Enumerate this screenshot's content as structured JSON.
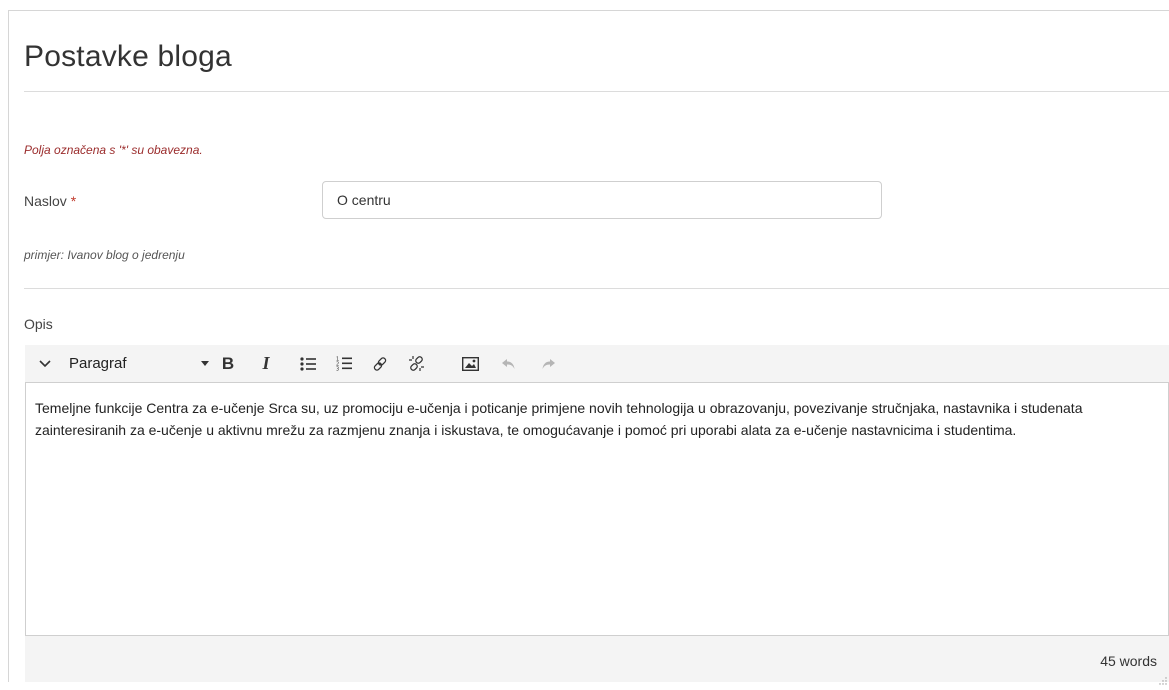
{
  "page": {
    "title": "Postavke bloga",
    "required_note": "Polja označena s '*' su obavezna."
  },
  "form": {
    "naslov_label": "Naslov",
    "required_mark": "*",
    "naslov_value": "O centru",
    "naslov_hint": "primjer: Ivanov blog o jedrenju",
    "opis_label": "Opis"
  },
  "editor": {
    "toolbar": {
      "collapse_icon": "chevron-down-icon",
      "format_value": "Paragraf",
      "bold_label": "B",
      "italic_label": "I",
      "icons": [
        "bullet-list-icon",
        "numbered-list-icon",
        "link-icon",
        "unlink-icon",
        "image-icon",
        "undo-icon",
        "redo-icon"
      ]
    },
    "content": "Temeljne funkcije Centra za e-učenje Srca su, uz promociju e-učenja i poticanje primjene novih tehnologija u obrazovanju, povezivanje stručnjaka, nastavnika i studenata zainteresiranih za e-učenje u aktivnu mrežu za razmjenu znanja i iskustava, te omogućavanje i pomoć pri uporabi alata za e-učenje nastavnicima i studentima.",
    "word_count": "45 words"
  },
  "colors": {
    "required": "#9b2c2c",
    "toolbar_bg": "#f4f4f4",
    "border": "#cfcfcf"
  }
}
